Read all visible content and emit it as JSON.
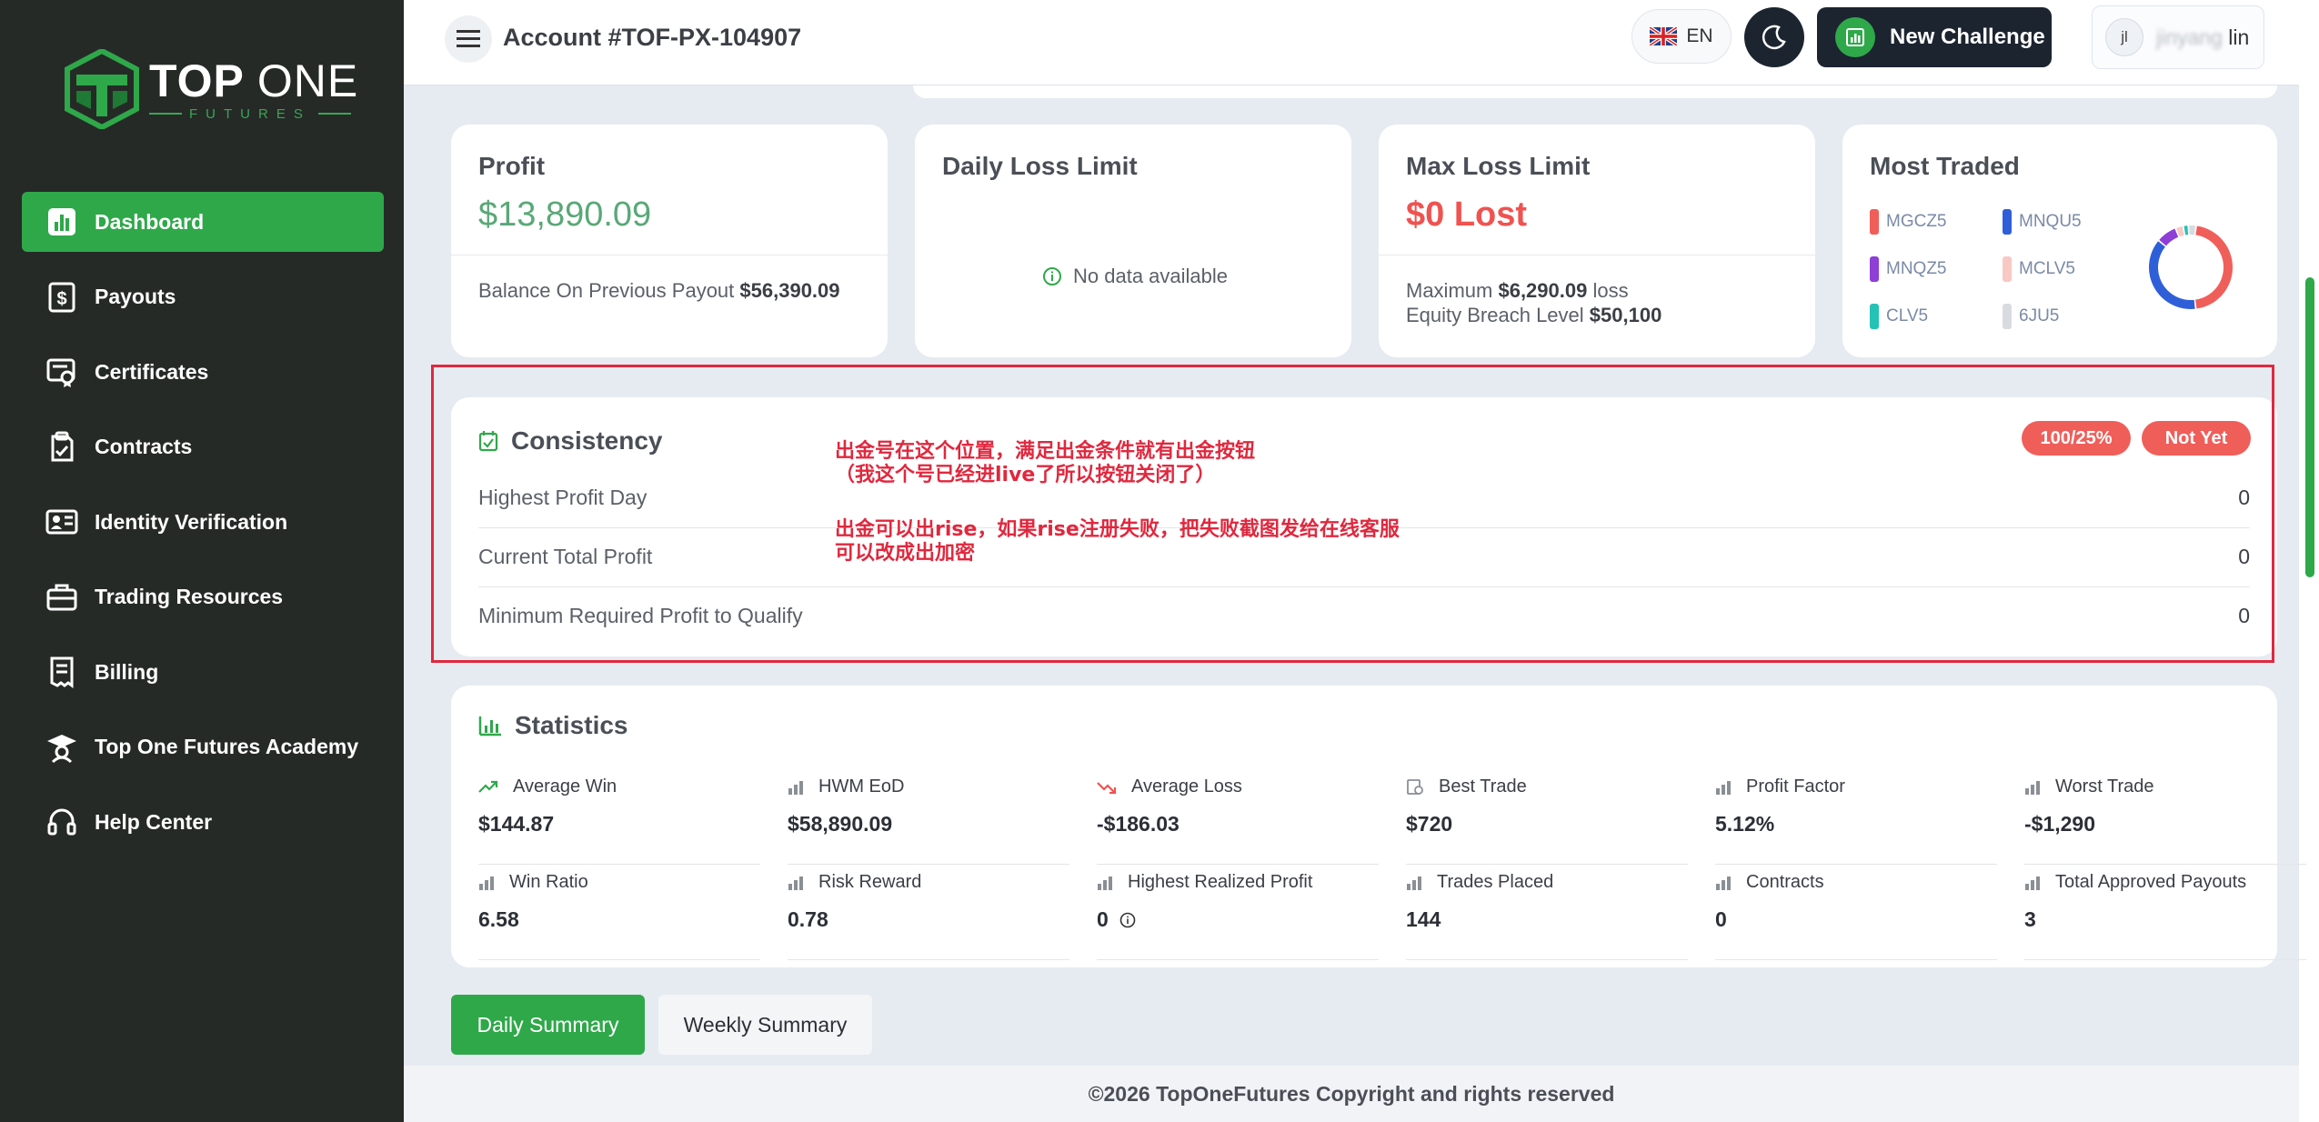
{
  "brand": {
    "name_bold": "TOP",
    "name_light": "ONE",
    "tagline": "FUTURES",
    "color": "#2fa84a"
  },
  "sidebar": {
    "items": [
      {
        "label": "Dashboard",
        "icon": "dashboard-icon",
        "active": true
      },
      {
        "label": "Payouts",
        "icon": "dollar-icon"
      },
      {
        "label": "Certificates",
        "icon": "certificate-icon"
      },
      {
        "label": "Contracts",
        "icon": "contract-icon"
      },
      {
        "label": "Identity Verification",
        "icon": "id-card-icon"
      },
      {
        "label": "Trading Resources",
        "icon": "briefcase-icon"
      },
      {
        "label": "Billing",
        "icon": "receipt-icon"
      },
      {
        "label": "Top One Futures Academy",
        "icon": "academy-icon"
      },
      {
        "label": "Help Center",
        "icon": "headset-icon"
      }
    ]
  },
  "header": {
    "account_title": "Account #TOF-PX-104907",
    "language": "EN",
    "new_challenge_label": "New Challenge",
    "user_initials": "jl",
    "user_name_visible": "lin"
  },
  "profit_card": {
    "title": "Profit",
    "value": "$13,890.09",
    "balance_label": "Balance On Previous Payout",
    "balance_value": "$56,390.09"
  },
  "daily_loss_card": {
    "title": "Daily Loss Limit",
    "empty_text": "No data available"
  },
  "max_loss_card": {
    "title": "Max Loss Limit",
    "value": "$0 Lost",
    "maximum_label": "Maximum",
    "maximum_value": "$6,290.09",
    "maximum_suffix": "loss",
    "breach_label": "Equity Breach Level",
    "breach_value": "$50,100"
  },
  "most_traded": {
    "title": "Most Traded",
    "items": [
      {
        "label": "MGCZ5",
        "color": "#f05e5a"
      },
      {
        "label": "MNQU5",
        "color": "#2f5fd8"
      },
      {
        "label": "MNQZ5",
        "color": "#8e3fd6"
      },
      {
        "label": "MCLV5",
        "color": "#f8c8c4"
      },
      {
        "label": "CLV5",
        "color": "#25c2b6"
      },
      {
        "label": "6JU5",
        "color": "#d8dbe0"
      }
    ],
    "chart_data": {
      "type": "pie",
      "labels": [
        "MGCZ5",
        "MNQU5",
        "MNQZ5",
        "MCLV5",
        "CLV5",
        "6JU5"
      ],
      "values": [
        46,
        38,
        8,
        3,
        2,
        3
      ]
    }
  },
  "consistency": {
    "title": "Consistency",
    "badge_ratio": "100/25%",
    "badge_status": "Not Yet",
    "rows": [
      {
        "label": "Highest Profit Day",
        "value": "0"
      },
      {
        "label": "Current Total Profit",
        "value": "0"
      },
      {
        "label": "Minimum Required Profit to Qualify",
        "value": "0"
      }
    ],
    "note_line1": "出金号在这个位置，满足出金条件就有出金按钮",
    "note_line2": "（我这个号已经进live了所以按钮关闭了）",
    "note_line3": "出金可以出rise，如果rise注册失败，把失败截图发给在线客服",
    "note_line4": "可以改成出加密"
  },
  "statistics": {
    "title": "Statistics",
    "items": [
      {
        "label": "Average Win",
        "value": "$144.87",
        "icon": "trend-up-icon"
      },
      {
        "label": "HWM EoD",
        "value": "$58,890.09",
        "icon": "bar-chart-icon"
      },
      {
        "label": "Average Loss",
        "value": "-$186.03",
        "icon": "trend-down-icon"
      },
      {
        "label": "Best Trade",
        "value": "$720",
        "icon": "best-trade-icon"
      },
      {
        "label": "Profit Factor",
        "value": "5.12%",
        "icon": "bar-chart-icon"
      },
      {
        "label": "Worst Trade",
        "value": "-$1,290",
        "icon": "bar-chart-icon"
      },
      {
        "label": "Win Ratio",
        "value": "6.58",
        "icon": "bar-chart-icon"
      },
      {
        "label": "Risk Reward",
        "value": "0.78",
        "icon": "bar-chart-icon"
      },
      {
        "label": "Highest Realized Profit",
        "value": "0",
        "icon": "bar-chart-icon"
      },
      {
        "label": "Trades Placed",
        "value": "144",
        "icon": "bar-chart-icon"
      },
      {
        "label": "Contracts",
        "value": "0",
        "icon": "bar-chart-icon"
      },
      {
        "label": "Total Approved Payouts",
        "value": "3",
        "icon": "bar-chart-icon"
      }
    ]
  },
  "tabs": {
    "daily": "Daily Summary",
    "weekly": "Weekly Summary"
  },
  "footer": {
    "text": "©2026 TopOneFutures Copyright and rights reserved"
  }
}
